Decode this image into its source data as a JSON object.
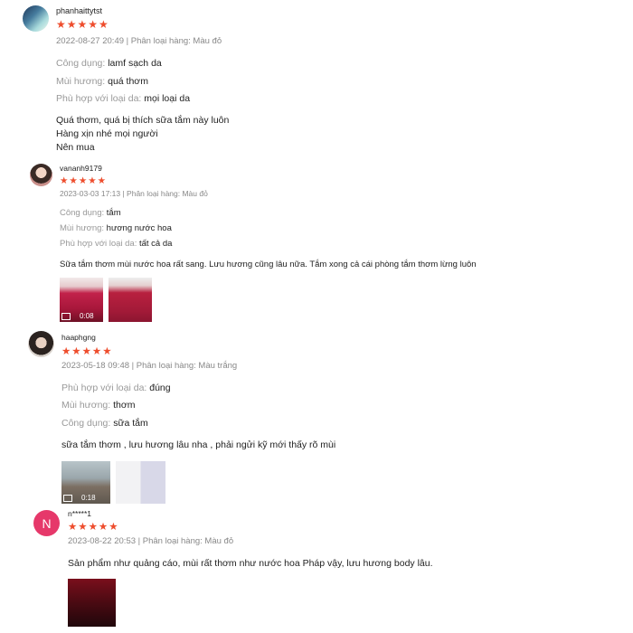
{
  "reviews": [
    {
      "username": "phanhaittytst",
      "stars": "★★★★★",
      "meta": "2022-08-27 20:49 | Phân loại hàng: Màu đỏ",
      "attrs": [
        {
          "k": "Công dụng:",
          "v": "lamf sạch da"
        },
        {
          "k": "Mùi hương:",
          "v": "quá thơm"
        },
        {
          "k": "Phù hợp với loại da:",
          "v": "mọi loại da"
        }
      ],
      "body": [
        "Quá thơm, quá bị thích sữa tắm này luôn",
        "Hàng xịn nhé mọi người",
        "Nên mua"
      ]
    },
    {
      "username": "vananh9179",
      "stars": "★★★★★",
      "meta": "2023-03-03 17:13 | Phân loại hàng: Màu đỏ",
      "attrs": [
        {
          "k": "Công dụng:",
          "v": "tắm"
        },
        {
          "k": "Mùi hương:",
          "v": "hương nước hoa"
        },
        {
          "k": "Phù hợp với loại da:",
          "v": "tất cả da"
        }
      ],
      "body": [
        "Sữa tắm thơm mùi nước hoa rất sang. Lưu hương cũng lâu nữa. Tắm xong cả cái phòng tắm thơm lừng luôn"
      ],
      "video_duration": "0:08"
    },
    {
      "username": "haaphgng",
      "stars": "★★★★★",
      "meta": "2023-05-18 09:48 | Phân loại hàng: Màu trắng",
      "attrs": [
        {
          "k": "Phù hợp với loại da:",
          "v": "đúng"
        },
        {
          "k": "Mùi hương:",
          "v": "thơm"
        },
        {
          "k": "Công dụng:",
          "v": "sữa tắm"
        }
      ],
      "body": [
        "sữa tắm thơm , lưu hương lâu nha , phải ngửi kỹ mới thấy rõ mùi"
      ],
      "video_duration": "0:18"
    },
    {
      "avatar_letter": "N",
      "username": "n*****1",
      "stars": "★★★★★",
      "meta": "2023-08-22 20:53 | Phân loại hàng: Màu đỏ",
      "body": [
        "Sản phẩm như quảng cáo, mùi rất thơm như nước hoa Pháp vậy, lưu hương body lâu."
      ]
    }
  ],
  "colors": {
    "stars": "#ee4d2d",
    "avatar_letter_bg": "#e6386a"
  }
}
